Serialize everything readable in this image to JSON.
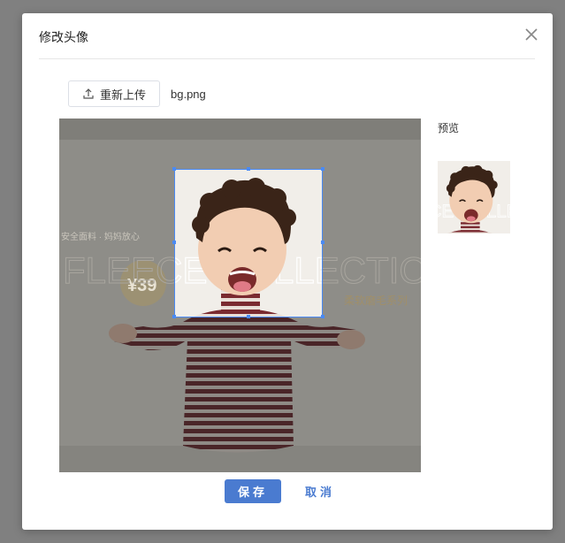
{
  "dialog": {
    "title": "修改头像",
    "close_icon": "close-icon"
  },
  "upload": {
    "button_label": "重新上传",
    "icon": "upload-icon",
    "file_name": "bg.png"
  },
  "crop_image": {
    "banner_texts": {
      "tagline": "安全面料 · 妈妈放心",
      "big_text": "FLEECE COLLECTION",
      "price": "¥39",
      "series": "柔软磨毛系列"
    }
  },
  "preview": {
    "label": "预览"
  },
  "actions": {
    "save_label": "保存",
    "cancel_label": "取消"
  },
  "colors": {
    "primary": "#4a7bd0",
    "overlay": "#808080",
    "crop_border": "#4a8af4"
  }
}
